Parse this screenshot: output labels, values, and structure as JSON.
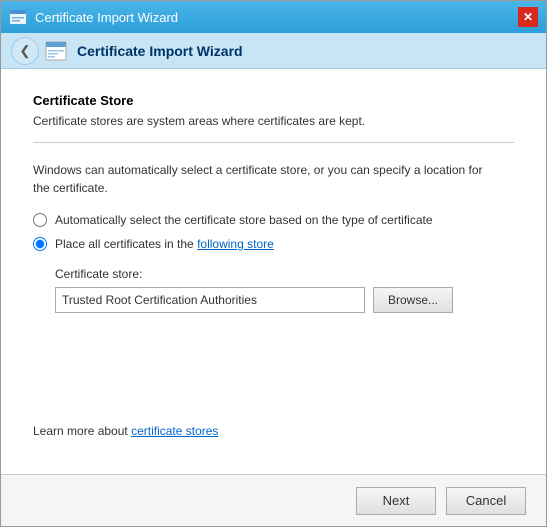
{
  "titleBar": {
    "title": "Certificate Import Wizard",
    "closeLabel": "✕"
  },
  "navBar": {
    "backArrow": "❮",
    "title": "Certificate Import Wizard"
  },
  "content": {
    "sectionTitle": "Certificate Store",
    "sectionDesc": "Certificate stores are system areas where certificates are kept.",
    "infoText1": "Windows can automatically select a certificate store, or you can specify a location for",
    "infoText2": "the certificate.",
    "radio1Label": "Automatically select the certificate store based on the type of certificate",
    "radio2Label": "Place all certificates in the following store",
    "certStoreLabel": "Certificate store:",
    "certStoreValue": "Trusted Root Certification Authorities",
    "browseBtnLabel": "Browse...",
    "learnMoreText": "Learn more about ",
    "learnMoreLink": "certificate stores"
  },
  "footer": {
    "nextLabel": "Next",
    "cancelLabel": "Cancel"
  }
}
